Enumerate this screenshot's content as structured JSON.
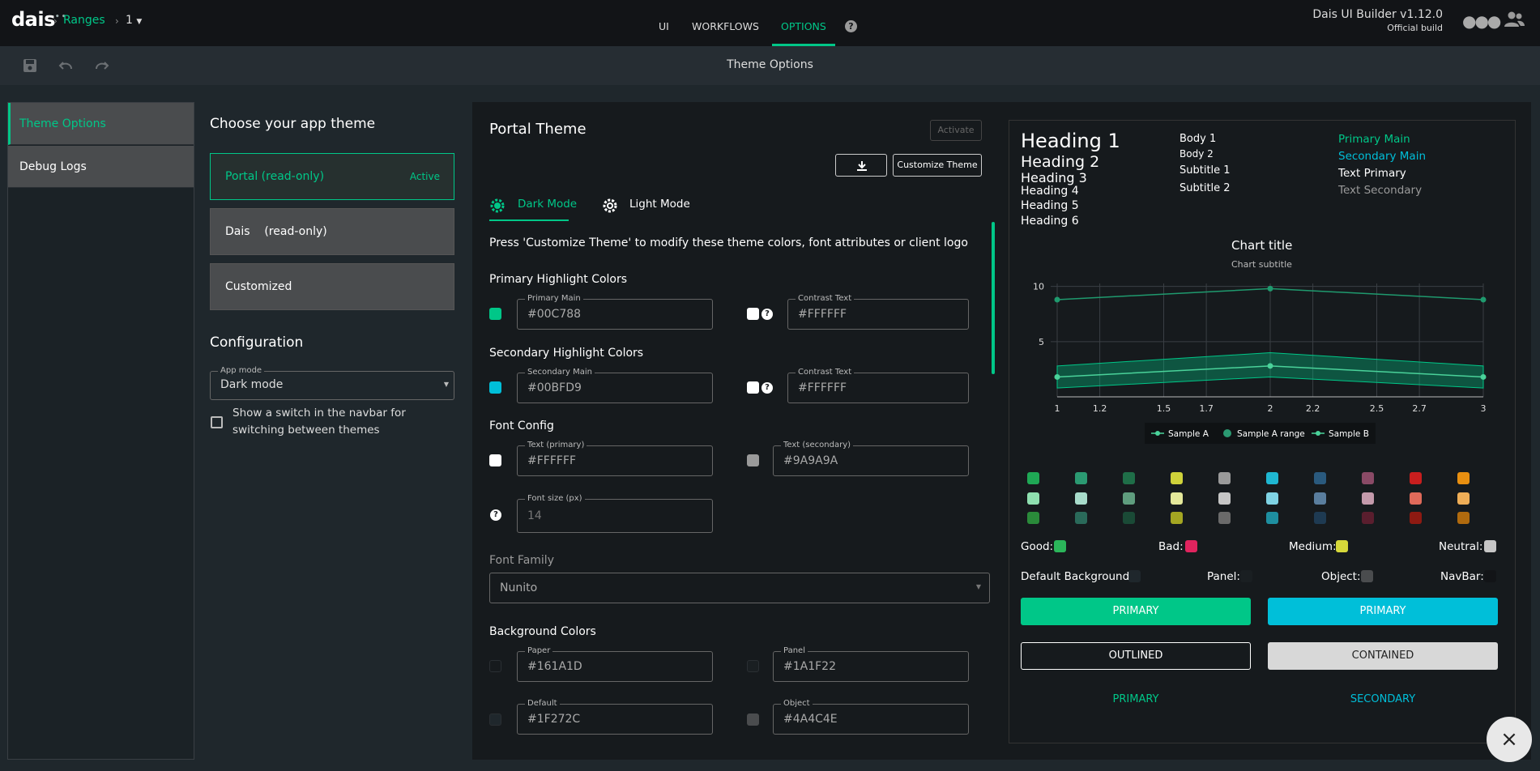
{
  "navbar": {
    "logo": "dais",
    "breadcrumb": [
      "Ranges",
      "1"
    ],
    "tabs": [
      "UI",
      "WORKFLOWS",
      "OPTIONS"
    ],
    "active_tab": "OPTIONS",
    "app_version": "Dais UI Builder v1.12.0",
    "build": "Official build"
  },
  "toolbar": {
    "title": "Theme Options"
  },
  "sidebar": {
    "items": [
      "Theme Options",
      "Debug Logs"
    ]
  },
  "themes": {
    "heading": "Choose your app theme",
    "cards": [
      {
        "label": "Portal (read-only)",
        "badge": "Active"
      },
      {
        "label": "Dais    (read-only)"
      },
      {
        "label": "Customized"
      }
    ]
  },
  "configuration": {
    "heading": "Configuration",
    "app_mode_label": "App mode",
    "app_mode_value": "Dark mode",
    "switch_label": "Show a switch in the navbar for switching between themes"
  },
  "panel": {
    "title": "Portal Theme",
    "activate": "Activate",
    "customize": "Customize Theme",
    "mode_tabs": [
      "Dark Mode",
      "Light Mode"
    ],
    "instruction": "Press 'Customize Theme' to modify these theme colors, font attributes or client logo",
    "primary": {
      "heading": "Primary Highlight Colors",
      "main_label": "Primary Main",
      "main_value": "#00C788",
      "contrast_label": "Contrast Text",
      "contrast_value": "#FFFFFF",
      "color": "#00C788"
    },
    "secondary": {
      "heading": "Secondary Highlight Colors",
      "main_label": "Secondary Main",
      "main_value": "#00BFD9",
      "contrast_label": "Contrast Text",
      "contrast_value": "#FFFFFF",
      "color": "#00BFD9"
    },
    "font": {
      "heading": "Font Config",
      "primary_label": "Text (primary)",
      "primary_value": "#FFFFFF",
      "secondary_label": "Text (secondary)",
      "secondary_value": "#9A9A9A",
      "size_label": "Font size (px)",
      "size_value": "14"
    },
    "font_family": {
      "label": "Font Family",
      "value": "Nunito"
    },
    "background": {
      "heading": "Background Colors",
      "paper_label": "Paper",
      "paper_value": "#161A1D",
      "panel_label": "Panel",
      "panel_value": "#1A1F22",
      "default_label": "Default",
      "default_value": "#1F272C",
      "object_label": "Object",
      "object_value": "#4A4C4E"
    }
  },
  "preview": {
    "headings": [
      "Heading 1",
      "Heading 2",
      "Heading 3",
      "Heading 4",
      "Heading 5",
      "Heading 6"
    ],
    "body": [
      "Body 1",
      "Body 2",
      "Subtitle 1",
      "Subtitle 2"
    ],
    "colored": [
      "Primary Main",
      "Secondary Main",
      "Text Primary",
      "Text Secondary"
    ],
    "status": {
      "good": "Good:",
      "bad": "Bad:",
      "medium": "Medium:",
      "neutral": "Neutral:"
    },
    "bg_labels": {
      "default": "Default Background:",
      "panel": "Panel:",
      "object": "Object:",
      "navbar": "NavBar:"
    },
    "buttons": {
      "primary": "PRIMARY",
      "primary2": "PRIMARY",
      "outlined": "OUTLINED",
      "contained": "CONTAINED",
      "text_primary": "PRIMARY",
      "text_secondary": "SECONDARY"
    },
    "palette": [
      [
        "#1fa855",
        "#2b9a72",
        "#1f6e48",
        "#cfd23a",
        "#9a9a9a",
        "#1fb7d2",
        "#2a5a7e",
        "#8a4a66",
        "#c81e1e",
        "#e88f10"
      ],
      [
        "#8fe0b0",
        "#a8dccb",
        "#5f9d7e",
        "#e4e89a",
        "#c6c6c6",
        "#7fd3e4",
        "#5a7e9e",
        "#c49aab",
        "#e06a5a",
        "#efae57"
      ],
      [
        "#2a8a3a",
        "#2a6a5a",
        "#1a4a36",
        "#a4a622",
        "#6a6a6a",
        "#1e8fa0",
        "#1e3a52",
        "#5a1e2e",
        "#8e1a12",
        "#b06a0e"
      ]
    ]
  },
  "chart_data": {
    "type": "line",
    "title": "Chart title",
    "subtitle": "Chart subtitle",
    "x": [
      1,
      1.2,
      1.5,
      1.7,
      2,
      2.2,
      2.5,
      2.7,
      3
    ],
    "xticks": [
      "1",
      "1.2",
      "1.5",
      "1.7",
      "2",
      "2.2",
      "2.5",
      "2.7",
      "3"
    ],
    "yticks": [
      "5",
      "10"
    ],
    "ylim": [
      0,
      11
    ],
    "series": [
      {
        "name": "Sample A",
        "x": [
          1,
          2,
          3
        ],
        "values": [
          1.8,
          2.8,
          1.8
        ]
      },
      {
        "name": "Sample A range",
        "x": [
          1,
          2,
          3
        ],
        "low": [
          0.8,
          1.8,
          0.8
        ],
        "high": [
          2.8,
          4.0,
          2.8
        ]
      },
      {
        "name": "Sample B",
        "x": [
          1,
          2,
          3
        ],
        "values": [
          8.8,
          9.8,
          8.8
        ]
      }
    ],
    "legend": "bottom"
  }
}
